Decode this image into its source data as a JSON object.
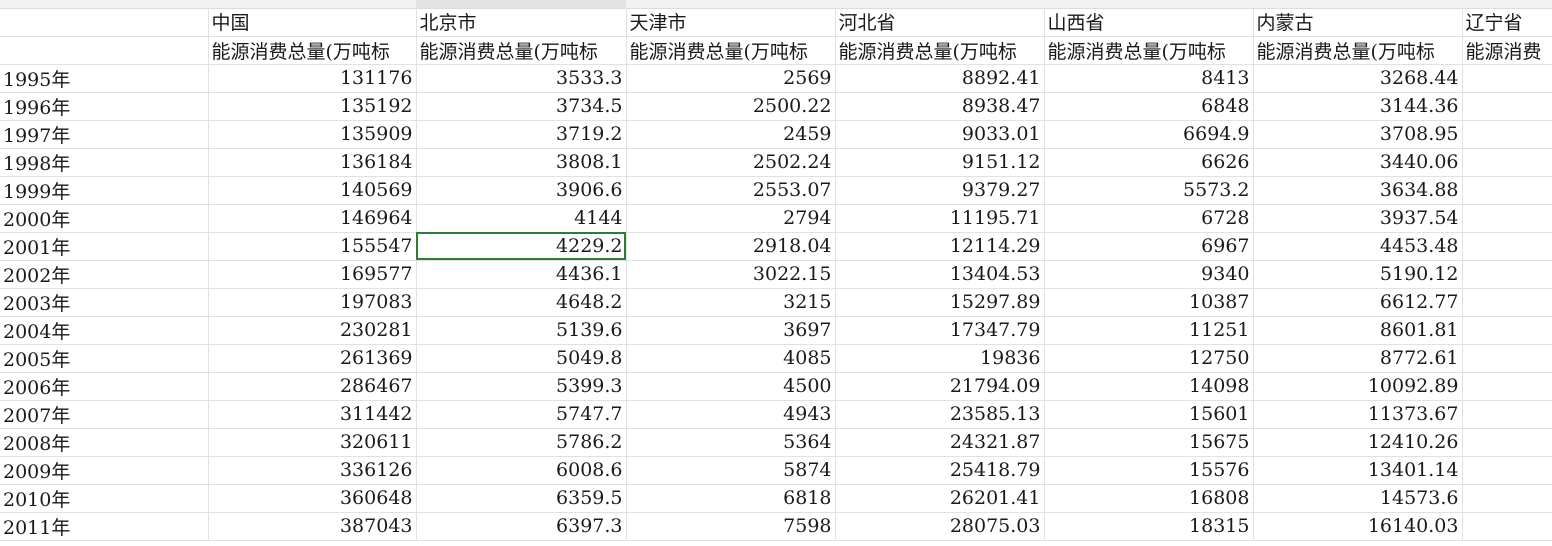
{
  "header": {
    "columns": [
      "中国",
      "北京市",
      "天津市",
      "河北省",
      "山西省",
      "内蒙古",
      "辽宁省"
    ],
    "subtitle": "能源消费总量(万吨标",
    "subtitle_last": "能源消费"
  },
  "rows": [
    {
      "year": "1995年",
      "values": [
        "131176",
        "3533.3",
        "2569",
        "8892.41",
        "8413",
        "3268.44"
      ]
    },
    {
      "year": "1996年",
      "values": [
        "135192",
        "3734.5",
        "2500.22",
        "8938.47",
        "6848",
        "3144.36"
      ]
    },
    {
      "year": "1997年",
      "values": [
        "135909",
        "3719.2",
        "2459",
        "9033.01",
        "6694.9",
        "3708.95"
      ]
    },
    {
      "year": "1998年",
      "values": [
        "136184",
        "3808.1",
        "2502.24",
        "9151.12",
        "6626",
        "3440.06"
      ]
    },
    {
      "year": "1999年",
      "values": [
        "140569",
        "3906.6",
        "2553.07",
        "9379.27",
        "5573.2",
        "3634.88"
      ]
    },
    {
      "year": "2000年",
      "values": [
        "146964",
        "4144",
        "2794",
        "11195.71",
        "6728",
        "3937.54"
      ]
    },
    {
      "year": "2001年",
      "values": [
        "155547",
        "4229.2",
        "2918.04",
        "12114.29",
        "6967",
        "4453.48"
      ]
    },
    {
      "year": "2002年",
      "values": [
        "169577",
        "4436.1",
        "3022.15",
        "13404.53",
        "9340",
        "5190.12"
      ]
    },
    {
      "year": "2003年",
      "values": [
        "197083",
        "4648.2",
        "3215",
        "15297.89",
        "10387",
        "6612.77"
      ]
    },
    {
      "year": "2004年",
      "values": [
        "230281",
        "5139.6",
        "3697",
        "17347.79",
        "11251",
        "8601.81"
      ]
    },
    {
      "year": "2005年",
      "values": [
        "261369",
        "5049.8",
        "4085",
        "19836",
        "12750",
        "8772.61"
      ]
    },
    {
      "year": "2006年",
      "values": [
        "286467",
        "5399.3",
        "4500",
        "21794.09",
        "14098",
        "10092.89"
      ]
    },
    {
      "year": "2007年",
      "values": [
        "311442",
        "5747.7",
        "4943",
        "23585.13",
        "15601",
        "11373.67"
      ]
    },
    {
      "year": "2008年",
      "values": [
        "320611",
        "5786.2",
        "5364",
        "24321.87",
        "15675",
        "12410.26"
      ]
    },
    {
      "year": "2009年",
      "values": [
        "336126",
        "6008.6",
        "5874",
        "25418.79",
        "15576",
        "13401.14"
      ]
    },
    {
      "year": "2010年",
      "values": [
        "360648",
        "6359.5",
        "6818",
        "26201.41",
        "16808",
        "14573.6"
      ]
    },
    {
      "year": "2011年",
      "values": [
        "387043",
        "6397.3",
        "7598",
        "28075.03",
        "18315",
        "16140.03"
      ]
    }
  ],
  "active_cell": {
    "row": 6,
    "col": 1
  },
  "colors": {
    "grid": "#e2e2e2",
    "active_border": "#2e7d32"
  }
}
